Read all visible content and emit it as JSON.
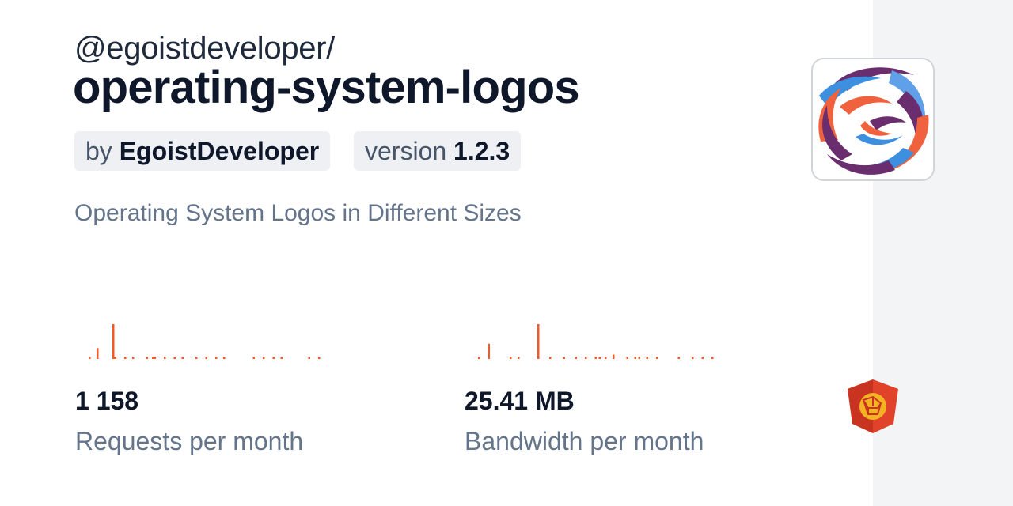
{
  "header": {
    "scope": "@egoistdeveloper/",
    "package_name": "operating-system-logos"
  },
  "badges": {
    "author_prefix": "by",
    "author_name": "EgoistDeveloper",
    "version_prefix": "version",
    "version_number": "1.2.3"
  },
  "description": "Operating System Logos in Different Sizes",
  "stats": {
    "requests": {
      "value": "1 158",
      "label": "Requests per month",
      "sparkline": [
        1,
        0,
        0,
        0,
        5,
        0,
        0,
        0,
        0,
        0,
        0,
        0,
        16,
        1,
        0,
        0,
        0,
        0,
        1,
        0,
        0,
        0,
        1,
        0,
        0,
        0,
        0,
        0,
        0,
        1,
        0,
        0,
        1,
        1,
        0,
        0,
        0,
        0,
        1,
        0,
        0,
        0,
        0,
        1,
        0,
        0,
        0,
        1,
        0,
        0,
        0,
        0,
        0,
        0,
        1,
        0,
        0,
        0,
        0,
        1,
        0,
        0,
        0,
        0,
        1,
        0,
        0,
        0,
        1,
        0,
        0,
        0,
        0,
        0,
        0,
        0,
        0,
        0,
        0,
        0,
        0,
        0,
        0,
        1,
        0,
        0,
        0,
        0,
        1,
        0,
        0,
        0,
        0,
        1,
        0,
        0,
        0,
        1,
        0,
        0,
        0,
        0,
        0,
        0,
        0,
        0,
        0,
        0,
        0,
        0,
        0,
        1,
        0,
        0,
        0,
        0,
        1,
        0,
        0,
        0
      ]
    },
    "bandwidth": {
      "value": "25.41 MB",
      "label": "Bandwidth per month",
      "sparkline": [
        1,
        0,
        0,
        0,
        0,
        7,
        0,
        0,
        0,
        0,
        0,
        0,
        0,
        0,
        0,
        0,
        1,
        0,
        0,
        0,
        1,
        0,
        0,
        0,
        0,
        0,
        0,
        0,
        0,
        0,
        16,
        0,
        0,
        0,
        0,
        0,
        1,
        0,
        0,
        0,
        0,
        0,
        0,
        1,
        0,
        0,
        0,
        0,
        0,
        1,
        0,
        0,
        0,
        0,
        1,
        0,
        0,
        0,
        0,
        1,
        0,
        1,
        0,
        0,
        1,
        0,
        0,
        0,
        2,
        0,
        0,
        0,
        0,
        0,
        0,
        1,
        0,
        0,
        0,
        1,
        0,
        1,
        0,
        0,
        0,
        1,
        0,
        0,
        0,
        0,
        1,
        0,
        0,
        0,
        0,
        0,
        0,
        0,
        0,
        0,
        0,
        1,
        0,
        0,
        0,
        0,
        0,
        0,
        1,
        0,
        0,
        0,
        0,
        1,
        0,
        0,
        0,
        0,
        1,
        0
      ]
    }
  },
  "colors": {
    "accent": "#f05a28",
    "title": "#0f172a",
    "muted": "#64748b",
    "badge_bg": "#eef0f4",
    "side_strip": "#f3f4f6",
    "cdn_logo": "#e0432a"
  },
  "icons": {
    "package_logo": "swirl-logo-icon",
    "cdn_logo": "jsdelivr-logo-icon"
  }
}
